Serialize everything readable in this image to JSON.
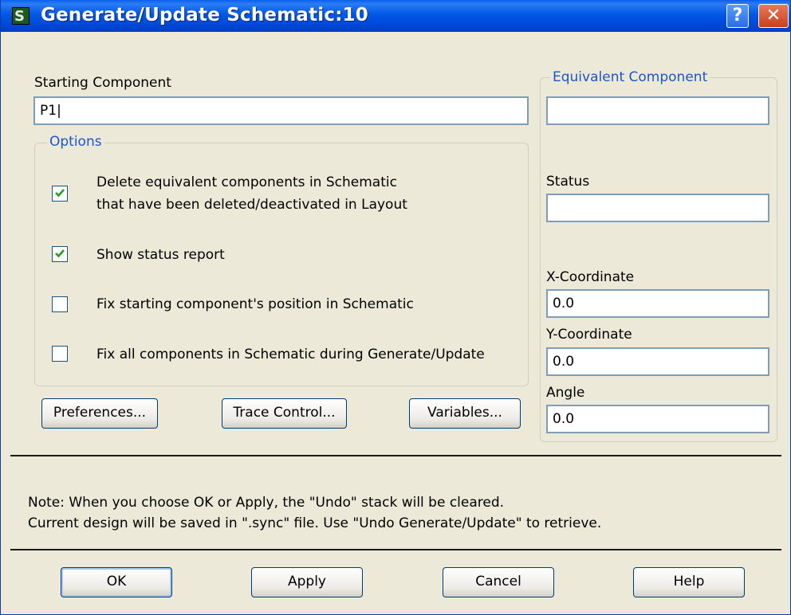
{
  "window": {
    "title": "Generate/Update Schematic:10",
    "help_glyph": "?",
    "close_glyph": "✕",
    "app_icon_letter": "S"
  },
  "starting_component": {
    "label": "Starting Component",
    "value": "P1|"
  },
  "options": {
    "legend": "Options",
    "items": [
      {
        "line1": "Delete equivalent components in Schematic",
        "line2": "that have been deleted/deactivated in Layout",
        "checked": true
      },
      {
        "line1": "Show status report",
        "checked": true
      },
      {
        "line1": "Fix starting component's position in Schematic",
        "checked": false
      },
      {
        "line1": "Fix all components in Schematic during Generate/Update",
        "checked": false
      }
    ]
  },
  "buttons_row": {
    "preferences": "Preferences...",
    "trace_control": "Trace Control...",
    "variables": "Variables..."
  },
  "equivalent": {
    "legend": "Equivalent Component",
    "value": "",
    "status_label": "Status",
    "status_value": "",
    "x_label": "X-Coordinate",
    "x_value": "0.0",
    "y_label": "Y-Coordinate",
    "y_value": "0.0",
    "angle_label": "Angle",
    "angle_value": "0.0"
  },
  "note": {
    "line1": "Note: When you choose OK or Apply, the \"Undo\" stack will be cleared.",
    "line2": "Current design will be saved in \".sync\" file. Use \"Undo Generate/Update\" to retrieve."
  },
  "footer": {
    "ok": "OK",
    "apply": "Apply",
    "cancel": "Cancel",
    "help": "Help"
  },
  "colors": {
    "titlebar": "#0058e6",
    "dialog_bg": "#ece9d8",
    "group_legend": "#1c55c8",
    "check_mark": "#21a121"
  }
}
